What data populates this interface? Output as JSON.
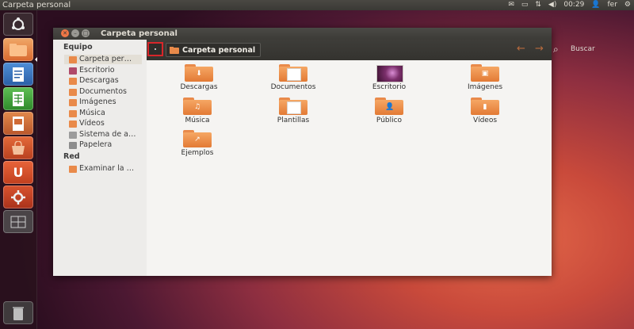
{
  "topbar": {
    "title": "Carpeta personal",
    "time": "00:29",
    "user": "fer"
  },
  "launcher": {
    "items": [
      "ubuntu-dash",
      "files",
      "writer",
      "calc",
      "impress",
      "software-center",
      "ubuntu-one",
      "system-settings",
      "workspace-switcher",
      "trash"
    ]
  },
  "window": {
    "title": "Carpeta personal",
    "sidebar": {
      "sections": [
        {
          "heading": "Equipo",
          "items": [
            "Carpeta per…",
            "Escritorio",
            "Descargas",
            "Documentos",
            "Imágenes",
            "Música",
            "Vídeos",
            "Sistema de a…",
            "Papelera"
          ]
        },
        {
          "heading": "Red",
          "items": [
            "Examinar la …"
          ]
        }
      ]
    },
    "toolbar": {
      "breadcrumb": "Carpeta personal",
      "search_label": "Buscar"
    },
    "folders": [
      "Descargas",
      "Documentos",
      "Escritorio",
      "Imágenes",
      "Música",
      "Plantillas",
      "Público",
      "Vídeos",
      "Ejemplos"
    ]
  },
  "colors": {
    "accent": "#e37a35",
    "selection_outline": "#d8262a"
  }
}
